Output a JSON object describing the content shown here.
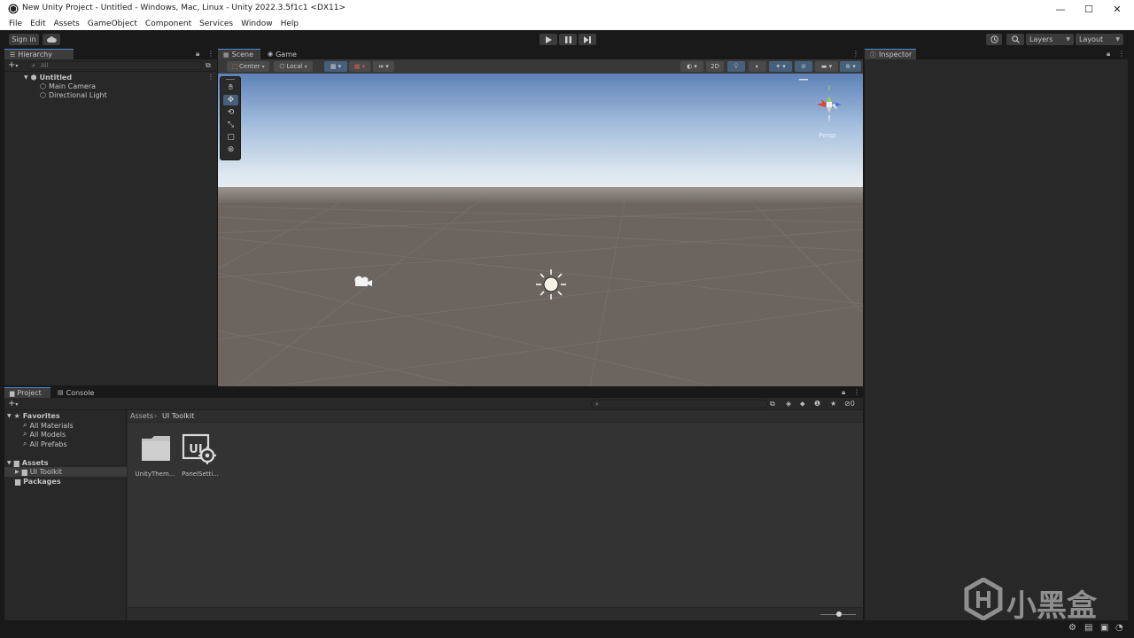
{
  "window": {
    "title": "New Unity Project - Untitled - Windows, Mac, Linux - Unity 2022.3.5f1c1 <DX11>",
    "minimize": "—",
    "maximize": "☐",
    "close": "✕"
  },
  "menu": [
    "File",
    "Edit",
    "Assets",
    "GameObject",
    "Component",
    "Services",
    "Window",
    "Help"
  ],
  "toolbar": {
    "sign_in": "Sign in",
    "layers": "Layers",
    "layout": "Layout"
  },
  "hierarchy": {
    "tab": "Hierarchy",
    "search_placeholder": "All",
    "scene": "Untitled",
    "items": [
      "Main Camera",
      "Directional Light"
    ]
  },
  "scene_view": {
    "tabs": [
      "Scene",
      "Game"
    ],
    "pivot": "Center",
    "space": "Local",
    "mode_2d": "2D",
    "gizmo_label": "Persp"
  },
  "inspector": {
    "tab": "Inspector"
  },
  "project": {
    "tabs": [
      "Project",
      "Console"
    ],
    "favorites_label": "Favorites",
    "favorites": [
      "All Materials",
      "All Models",
      "All Prefabs"
    ],
    "assets_label": "Assets",
    "assets_children": [
      "UI Toolkit"
    ],
    "packages_label": "Packages",
    "breadcrumb": [
      "Assets",
      "UI Toolkit"
    ],
    "hidden_count": "0",
    "files": [
      {
        "name": "UnityThem...",
        "icon": "folder-icon"
      },
      {
        "name": "PanelSetti...",
        "icon": "panel-settings-icon"
      }
    ]
  },
  "watermark": {
    "text": "小黑盒"
  },
  "colors": {
    "accent": "#46607c",
    "tab_highlight": "#4a8ad6",
    "panel_bg": "#282828",
    "sky_top": "#5e82b8",
    "ground": "#6b645f"
  }
}
